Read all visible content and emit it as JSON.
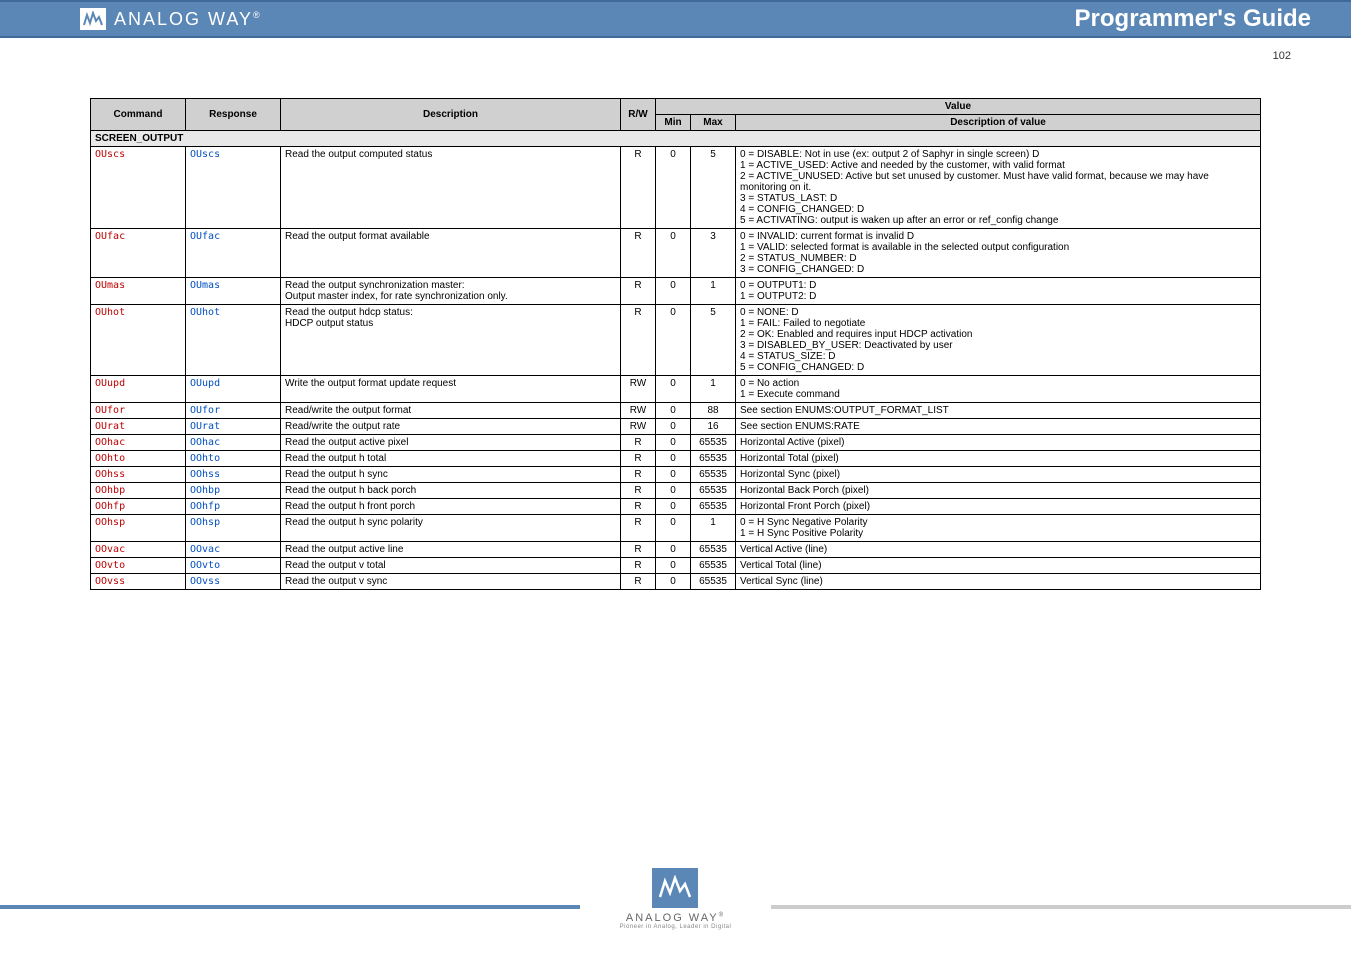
{
  "header": {
    "brand": "ANALOG WAY",
    "brand_mark": "®",
    "title": "Programmer's Guide"
  },
  "page_number": "102",
  "table": {
    "headers": {
      "cmd": "Command",
      "rsp": "Response",
      "desc": "Description",
      "rw": "R/W",
      "val": "Value",
      "min": "Min",
      "max": "Max",
      "vdesc": "Description of value"
    },
    "group_label": "SCREEN_OUTPUT",
    "rows": [
      {
        "cmd": "OUscs",
        "rsp": "OUscs",
        "desc": "Read the output computed status",
        "rw": "R",
        "min": "0",
        "max": "5",
        "vdesc": "0 = DISABLE: Not in use  (ex: output 2 of Saphyr in single screen) D\n1 = ACTIVE_USED: Active and needed by the customer, with valid format\n2 = ACTIVE_UNUSED: Active but set unused by customer. Must have valid format, because we may have monitoring on it.\n3 = STATUS_LAST: D\n4 = CONFIG_CHANGED: D\n5 = ACTIVATING: output is waken up after an error or ref_config change"
      },
      {
        "cmd": "OUfac",
        "rsp": "OUfac",
        "desc": "Read the output format available",
        "rw": "R",
        "min": "0",
        "max": "3",
        "vdesc": "0 = INVALID: current format is invalid D\n1 = VALID: selected format is available in the selected output configuration\n2 = STATUS_NUMBER: D\n3 = CONFIG_CHANGED: D"
      },
      {
        "cmd": "OUmas",
        "rsp": "OUmas",
        "desc": "Read the output synchronization master:\nOutput master index, for rate synchronization only.",
        "rw": "R",
        "min": "0",
        "max": "1",
        "vdesc": "0 = OUTPUT1: D\n1 = OUTPUT2: D"
      },
      {
        "cmd": "OUhot",
        "rsp": "OUhot",
        "desc": "Read the output hdcp status:\nHDCP output status",
        "rw": "R",
        "min": "0",
        "max": "5",
        "vdesc": "0 = NONE: D\n1 = FAIL: Failed to negotiate\n2 = OK: Enabled and requires input HDCP activation\n3 = DISABLED_BY_USER: Deactivated by user\n4 = STATUS_SIZE: D\n5 = CONFIG_CHANGED: D"
      },
      {
        "cmd": "OUupd",
        "rsp": "OUupd",
        "desc": "Write the output format update request",
        "rw": "RW",
        "min": "0",
        "max": "1",
        "vdesc": "0 = No action\n1 = Execute command"
      },
      {
        "cmd": "OUfor",
        "rsp": "OUfor",
        "desc": "Read/write the output format",
        "rw": "RW",
        "min": "0",
        "max": "88",
        "vdesc": "See section ENUMS:OUTPUT_FORMAT_LIST"
      },
      {
        "cmd": "OUrat",
        "rsp": "OUrat",
        "desc": "Read/write the output rate",
        "rw": "RW",
        "min": "0",
        "max": "16",
        "vdesc": "See section ENUMS:RATE"
      },
      {
        "cmd": "OOhac",
        "rsp": "OOhac",
        "desc": "Read the output active pixel",
        "rw": "R",
        "min": "0",
        "max": "65535",
        "vdesc": "Horizontal Active (pixel)"
      },
      {
        "cmd": "OOhto",
        "rsp": "OOhto",
        "desc": "Read the output h total",
        "rw": "R",
        "min": "0",
        "max": "65535",
        "vdesc": "Horizontal Total (pixel)"
      },
      {
        "cmd": "OOhss",
        "rsp": "OOhss",
        "desc": "Read the output h sync",
        "rw": "R",
        "min": "0",
        "max": "65535",
        "vdesc": "Horizontal Sync (pixel)"
      },
      {
        "cmd": "OOhbp",
        "rsp": "OOhbp",
        "desc": "Read the output h back porch",
        "rw": "R",
        "min": "0",
        "max": "65535",
        "vdesc": "Horizontal Back Porch (pixel)"
      },
      {
        "cmd": "OOhfp",
        "rsp": "OOhfp",
        "desc": "Read the output h front porch",
        "rw": "R",
        "min": "0",
        "max": "65535",
        "vdesc": "Horizontal Front Porch (pixel)"
      },
      {
        "cmd": "OOhsp",
        "rsp": "OOhsp",
        "desc": "Read the output h sync polarity",
        "rw": "R",
        "min": "0",
        "max": "1",
        "vdesc": "0 = H Sync Negative Polarity\n1 = H Sync Positive Polarity"
      },
      {
        "cmd": "OOvac",
        "rsp": "OOvac",
        "desc": "Read the output active line",
        "rw": "R",
        "min": "0",
        "max": "65535",
        "vdesc": "Vertical Active (line)"
      },
      {
        "cmd": "OOvto",
        "rsp": "OOvto",
        "desc": "Read the output v total",
        "rw": "R",
        "min": "0",
        "max": "65535",
        "vdesc": "Vertical Total (line)"
      },
      {
        "cmd": "OOvss",
        "rsp": "OOvss",
        "desc": "Read the output v sync",
        "rw": "R",
        "min": "0",
        "max": "65535",
        "vdesc": "Vertical Sync (line)"
      }
    ]
  },
  "footer": {
    "brand": "ANALOG WAY",
    "brand_mark": "®",
    "tagline": "Pioneer in Analog, Leader in Digital"
  }
}
